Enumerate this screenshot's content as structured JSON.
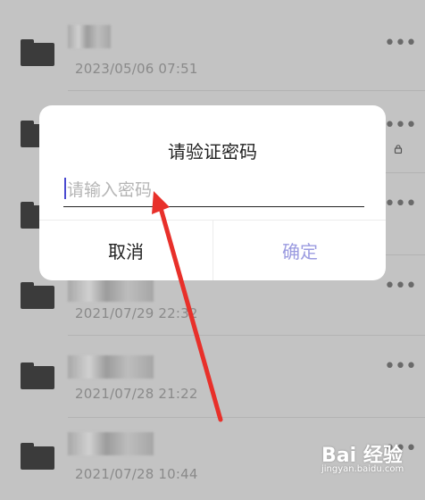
{
  "list": {
    "items": [
      {
        "date": "2023/05/06 07:51",
        "more_label": "•••"
      },
      {
        "date": "",
        "more_label": "•••"
      },
      {
        "date": "",
        "more_label": "•••"
      },
      {
        "date": "2021/07/29 22:32",
        "more_label": "•••"
      },
      {
        "date": "2021/07/28 21:22",
        "more_label": "•••"
      },
      {
        "date": "2021/07/28 10:44",
        "more_label": "•••"
      }
    ]
  },
  "dialog": {
    "title": "请验证密码",
    "password_placeholder": "请输入密码",
    "cancel_label": "取消",
    "confirm_label": "确定"
  },
  "watermark": {
    "logo": "Bai 经验",
    "sub": "jingyan.baidu.com"
  },
  "colors": {
    "accent": "#4a4ad0",
    "confirm_disabled": "#9b9be0",
    "annotation_arrow": "#e8302a"
  }
}
